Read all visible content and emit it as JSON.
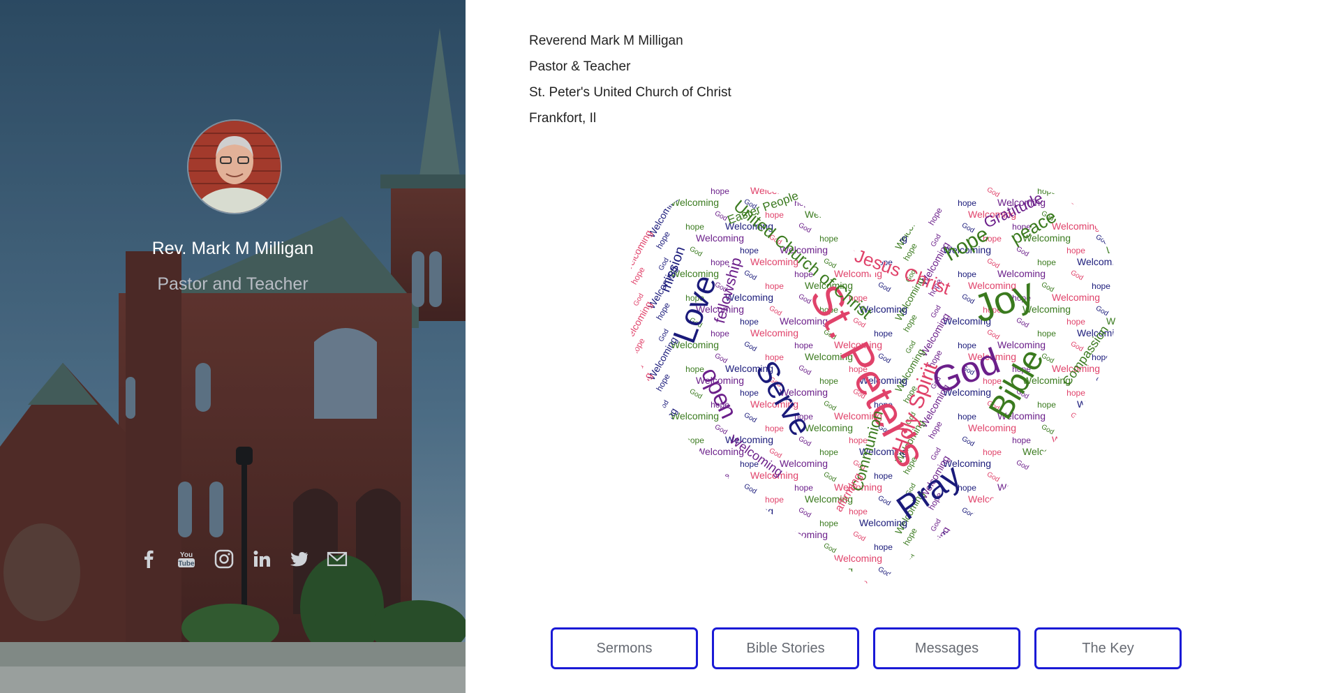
{
  "profile": {
    "name": "Rev. Mark M Milligan",
    "subtitle": "Pastor and Teacher",
    "avatar_icon": "person-photo"
  },
  "socials": [
    {
      "name": "facebook",
      "icon": "facebook-icon"
    },
    {
      "name": "youtube",
      "icon": "youtube-icon"
    },
    {
      "name": "instagram",
      "icon": "instagram-icon"
    },
    {
      "name": "linkedin",
      "icon": "linkedin-icon"
    },
    {
      "name": "twitter",
      "icon": "twitter-icon"
    },
    {
      "name": "email",
      "icon": "email-icon"
    }
  ],
  "info": {
    "line1": "Reverend Mark M Milligan",
    "line2": "Pastor & Teacher",
    "line3": "St. Peter's United Church of Christ",
    "line4": "Frankfort, Il"
  },
  "word_cloud": {
    "shape": "heart",
    "colors": [
      "#1a1a7a",
      "#6b1f8a",
      "#e0426a",
      "#3a7a1e"
    ],
    "words": [
      {
        "text": "St. Peter's",
        "color": "#e0426a"
      },
      {
        "text": "Love",
        "color": "#1a1a7a"
      },
      {
        "text": "Joy",
        "color": "#3a7a1e"
      },
      {
        "text": "God",
        "color": "#6b1f8a"
      },
      {
        "text": "Bible",
        "color": "#3a7a1e"
      },
      {
        "text": "Serve",
        "color": "#1a1a7a"
      },
      {
        "text": "Pray",
        "color": "#1a1a7a"
      },
      {
        "text": "Jesus Christ",
        "color": "#e0426a"
      },
      {
        "text": "Holy Spirit",
        "color": "#e0426a"
      },
      {
        "text": "United Church of Christ",
        "color": "#3a7a1e"
      },
      {
        "text": "hope",
        "color": "#3a7a1e"
      },
      {
        "text": "Gratitude",
        "color": "#6b1f8a"
      },
      {
        "text": "peace",
        "color": "#3a7a1e"
      },
      {
        "text": "open",
        "color": "#6b1f8a"
      },
      {
        "text": "fellowship",
        "color": "#6b1f8a"
      },
      {
        "text": "mission",
        "color": "#1a1a7a"
      },
      {
        "text": "Communion",
        "color": "#3a7a1e"
      },
      {
        "text": "Welcoming",
        "color": "#6b1f8a"
      },
      {
        "text": "Compassion",
        "color": "#3a7a1e"
      },
      {
        "text": "affirming",
        "color": "#e0426a"
      },
      {
        "text": "Easter People",
        "color": "#3a7a1e"
      }
    ]
  },
  "buttons": [
    {
      "label": "Sermons"
    },
    {
      "label": "Bible Stories"
    },
    {
      "label": "Messages"
    },
    {
      "label": "The Key"
    }
  ]
}
